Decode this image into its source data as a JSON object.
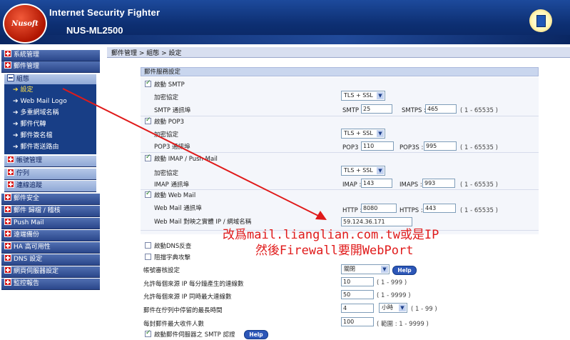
{
  "app": {
    "title": "Internet Security Fighter",
    "model": "NUS-ML2500",
    "logo_text": "Nusoft"
  },
  "sidebar": {
    "items": [
      {
        "label": "系統管理",
        "icon": "plus-box-icon"
      },
      {
        "label": "郵件管理",
        "icon": "plus-box-icon"
      },
      {
        "label": "組態",
        "icon": "minus-box-icon"
      },
      {
        "label": "帳號管理",
        "icon": "plus-box-icon"
      },
      {
        "label": "佇列",
        "icon": "plus-box-icon"
      },
      {
        "label": "連線追蹤",
        "icon": "plus-box-icon"
      },
      {
        "label": "郵件安全",
        "icon": "plus-box-icon"
      },
      {
        "label": "郵件 歸檔 / 稽核",
        "icon": "plus-box-icon"
      },
      {
        "label": "Push Mail",
        "icon": "plus-box-icon"
      },
      {
        "label": "遠端備份",
        "icon": "plus-box-icon"
      },
      {
        "label": "HA 高可用性",
        "icon": "plus-box-icon"
      },
      {
        "label": "DNS 設定",
        "icon": "plus-box-icon"
      },
      {
        "label": "網頁伺服器設定",
        "icon": "plus-box-icon"
      },
      {
        "label": "監控報告",
        "icon": "plus-box-icon"
      }
    ],
    "leaves": [
      {
        "label": "設定",
        "active": true
      },
      {
        "label": "Web Mail Logo"
      },
      {
        "label": "多重網域名稱"
      },
      {
        "label": "郵件代轉"
      },
      {
        "label": "郵件簽名檔"
      },
      {
        "label": "郵件寄送路由"
      }
    ]
  },
  "breadcrumb": "郵件管理 > 組態 > 設定",
  "section_title": "郵件服務設定",
  "smtp": {
    "enable_label": "啟動 SMTP",
    "enabled": true,
    "encryption_label": "加密協定",
    "encryption_value": "TLS + SSL",
    "port_label": "SMTP 通訊埠",
    "port_name": "SMTP :",
    "port": "25",
    "secure_name": "SMTPS :",
    "secure_port": "465",
    "range": "( 1 - 65535 )"
  },
  "pop3": {
    "enable_label": "啟動 POP3",
    "enabled": true,
    "encryption_label": "加密協定",
    "encryption_value": "TLS + SSL",
    "port_label": "POP3 通訊埠",
    "port_name": "POP3 :",
    "port": "110",
    "secure_name": "POP3S :",
    "secure_port": "995",
    "range": "( 1 - 65535 )"
  },
  "imap": {
    "enable_label": "啟動 IMAP / Push Mail",
    "enabled": true,
    "encryption_label": "加密協定",
    "encryption_value": "TLS + SSL",
    "port_label": "IMAP 通訊埠",
    "port_name": "IMAP :",
    "port": "143",
    "secure_name": "IMAPS :",
    "secure_port": "993",
    "range": "( 1 - 65535 )"
  },
  "webmail": {
    "enable_label": "啟動 Web Mail",
    "enabled": true,
    "port_label": "Web Mail 通訊埠",
    "port_name": "HTTP :",
    "port": "8080",
    "secure_name": "HTTPS :",
    "secure_port": "443",
    "range": "( 1 - 65535 )",
    "address_label": "Web Mail 對映之實體 IP / 網域名稱",
    "address": "59.124.36.171"
  },
  "dns_check": {
    "label": "啟動DNS反查",
    "enabled": false
  },
  "dict_block": {
    "label": "阻擋字典攻擊",
    "enabled": false
  },
  "account_audit": {
    "label": "帳號審核設定",
    "value": "關閉",
    "help": "Help"
  },
  "max_conn_per_min": {
    "label": "允許每個來源 IP 每分鐘產生的連線數",
    "value": "10",
    "range": "( 1 - 999 )"
  },
  "max_concurrent": {
    "label": "允許每個來源 IP 同時最大連線數",
    "value": "50",
    "range": "( 1 - 9999 )"
  },
  "queue_time": {
    "label": "郵件在佇列中停留的最長時間",
    "value": "4",
    "unit": "小時",
    "range": "( 1 - 99 )"
  },
  "max_recipients": {
    "label": "每封郵件最大收件人數",
    "value": "100",
    "range": "( 範圍 : 1 - 9999 )"
  },
  "smtp_auth": {
    "label": "啟動郵件伺服器之 SMTP 認證",
    "enabled": true,
    "help": "Help"
  },
  "annotation": {
    "line1": "改爲mail.lianglian.com.tw或是IP",
    "line2": "然後Firewall要開WebPort",
    "color": "#e01a1a"
  }
}
